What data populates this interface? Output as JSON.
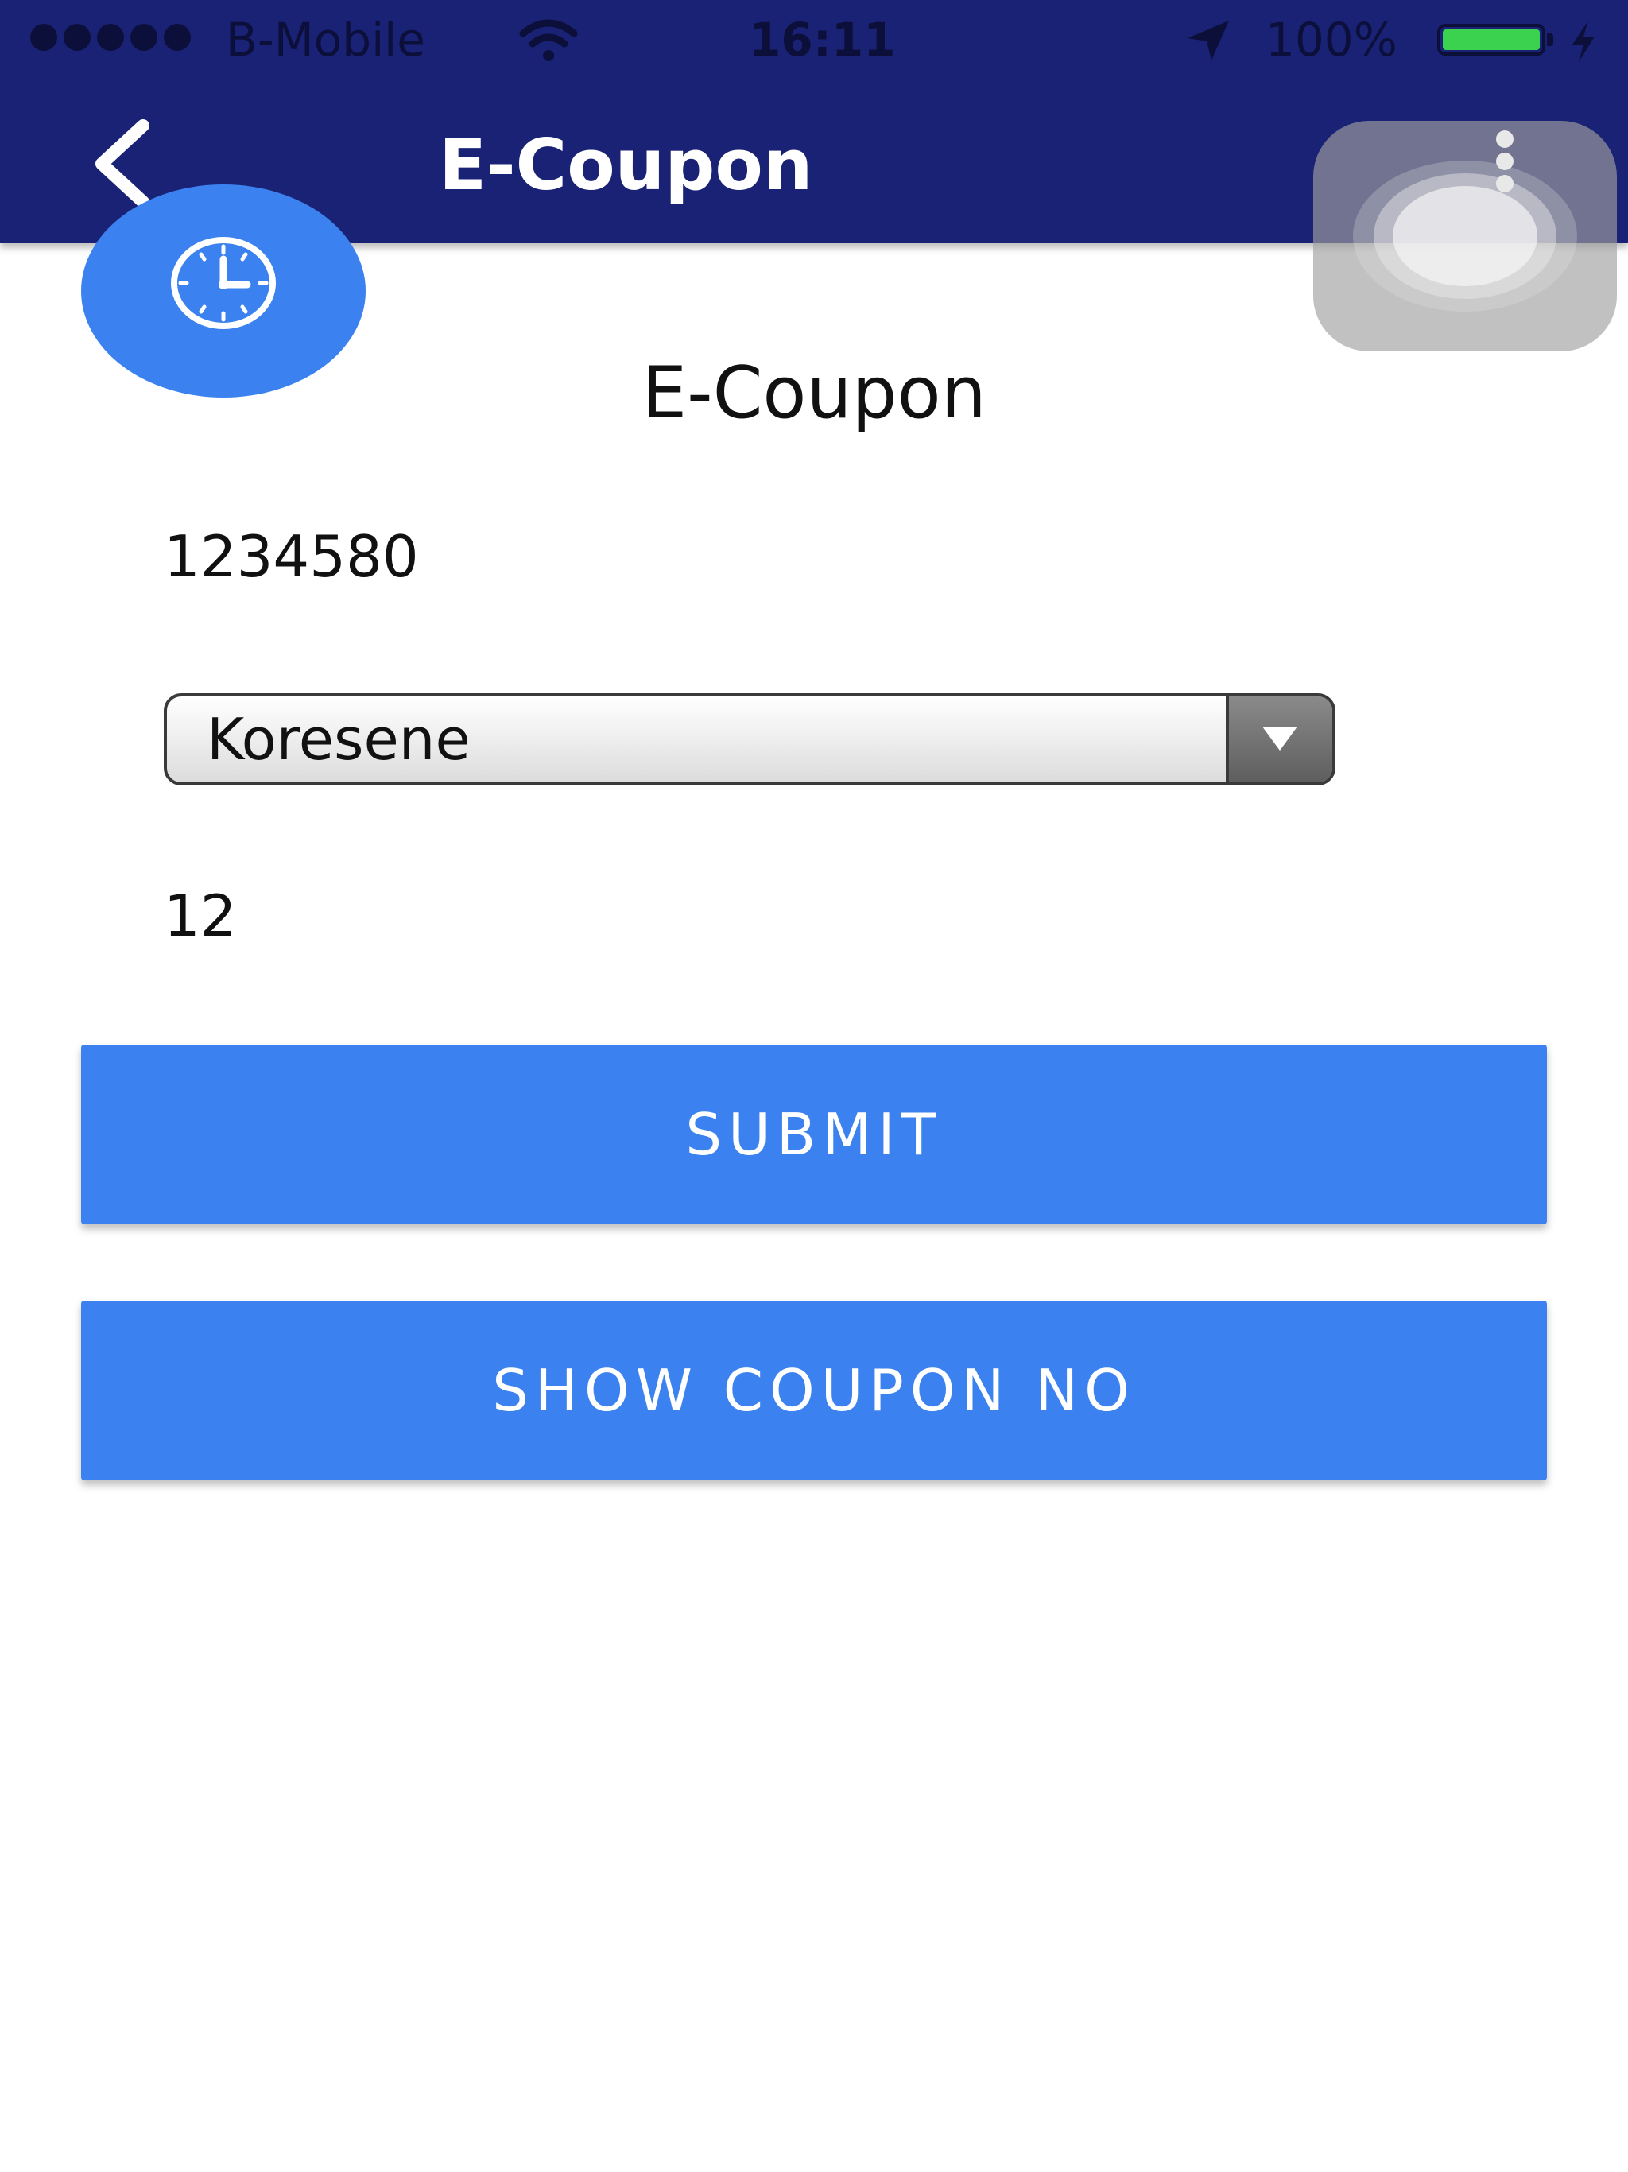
{
  "status_bar": {
    "carrier": "B-Mobile",
    "time": "16:11",
    "battery": "100%",
    "battery_level": 1.0
  },
  "nav": {
    "title": "E-Coupon"
  },
  "content": {
    "title": "E-Coupon",
    "coupon_number": "1234580",
    "fuel_select": {
      "selected": "Koresene"
    },
    "quantity": "12"
  },
  "buttons": {
    "submit": "SUBMIT",
    "show_coupon": "SHOW COUPON NO"
  },
  "colors": {
    "nav_bar": "#1a2275",
    "accent_blue": "#3b82f0",
    "battery_green": "#3ad24f"
  }
}
